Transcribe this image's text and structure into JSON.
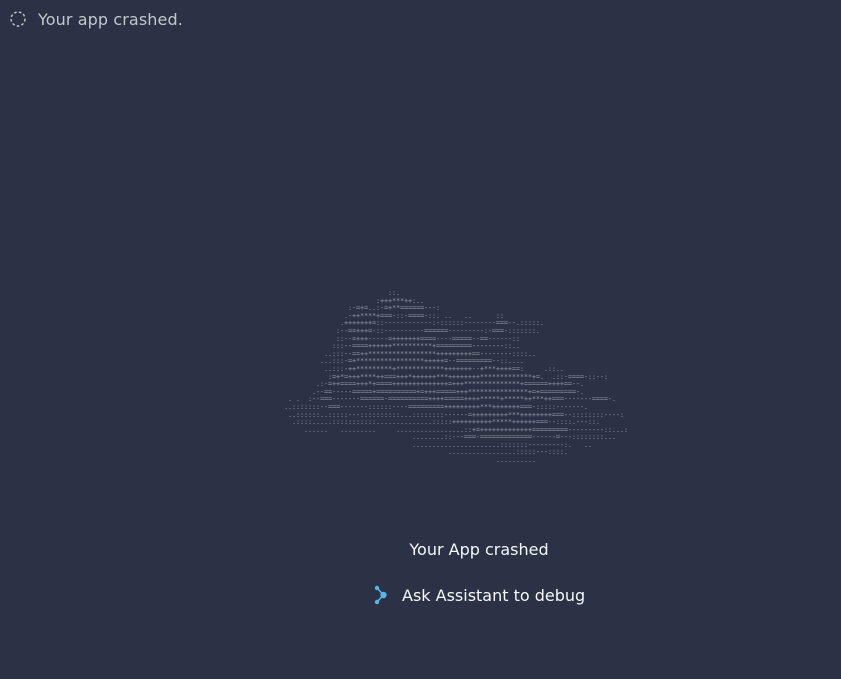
{
  "status": {
    "icon": "loading-spinner-icon",
    "text": "Your app crashed."
  },
  "art": {
    "text": "                           ::.\n                        :+++***++:..\n                 :-=+=..:-=+**======---:\n                .-++****+===-::-====-::. ..   ..      ::\n               .+++++++=::------------:-::::::--------===--.:::::.\n              :--==+++=-::----------======---------:-===-:::::::.\n              ::--=+++-----=+++++++====----=====--==------::\n             :::--====++++++**********+=========--------::..\n           ..:::--==++*****************+++++++++==--------::::..\n          ...:::-=+*****************+++++=--=========--::....\n           ..:::-++*********+************+++++++--+***++++==:     .::..\n            :=+*=+++****++===+++*++++++***++++++++*************+=.  .::-====-::--:\n         .:-=++====+++*+====++++++++++++++=+++**************+======++++==--.\n        .--==-----=====+==========+=+++=====+++***************+=+=========-.\n  . .  :--===-------======-==========++++=====++++*****+*****++***++===-------====-.\n ..:::::::--===-------::::::----=========+++++++++***+++++++===-:::::-------.\n  ..::::::..:::::---::::::::::...::::::::------=+++++++++***++++++++===--::::::::----:\n   .::::.....:::::::::::..............:::::++++++++++*****++++++===--::::.---::.\n      ......   .........     .................::+=+++++++++++++=========---------::...:\n                                 ........::---===-=============------=---::::::::...\n                                 ......................:::::::---------:.   ..\n                                          .................:::::---::::.\n                                                      .........."
  },
  "main": {
    "title": "Your App crashed",
    "debug_label": "Ask Assistant to debug",
    "debug_icon": "assistant-icon"
  },
  "colors": {
    "background": "#2b3245",
    "status_text": "#c2c8cc",
    "title_text": "#f5f9fc",
    "ascii_art": "#8e95a1",
    "assistant_icon": "#56b6e8"
  }
}
